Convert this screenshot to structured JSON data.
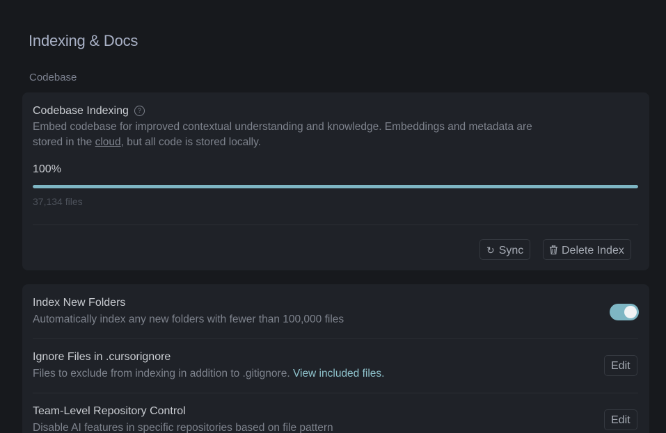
{
  "page": {
    "title": "Indexing & Docs"
  },
  "codebase_section": {
    "label": "Codebase",
    "indexing": {
      "title": "Codebase Indexing",
      "help_icon": "?",
      "description_part1": "Embed codebase for improved contextual understanding and knowledge. Embeddings and metadata are",
      "description_part2_prefix": "stored in the ",
      "description_link": "cloud",
      "description_part2_suffix": ", but all code is stored locally.",
      "progress_label": "100%",
      "progress_percent": 100,
      "files_count": "37,134 files",
      "sync_button": "Sync",
      "sync_icon": "refresh-icon",
      "delete_button": "Delete Index",
      "delete_icon": "trash-icon"
    }
  },
  "settings": {
    "index_new_folders": {
      "title": "Index New Folders",
      "description": "Automatically index any new folders with fewer than 100,000 files",
      "toggle_on": true
    },
    "ignore_files": {
      "title": "Ignore Files in .cursorignore",
      "description": "Files to exclude from indexing in addition to .gitignore.",
      "link": "View included files.",
      "edit_button": "Edit"
    },
    "team_repo_control": {
      "title": "Team-Level Repository Control",
      "description": "Disable AI features in specific repositories based on file pattern",
      "edit_button": "Edit"
    }
  },
  "colors": {
    "background": "#17191d",
    "card": "#1f2228",
    "accent": "#7eb6c4",
    "link": "#8fc3cc"
  }
}
